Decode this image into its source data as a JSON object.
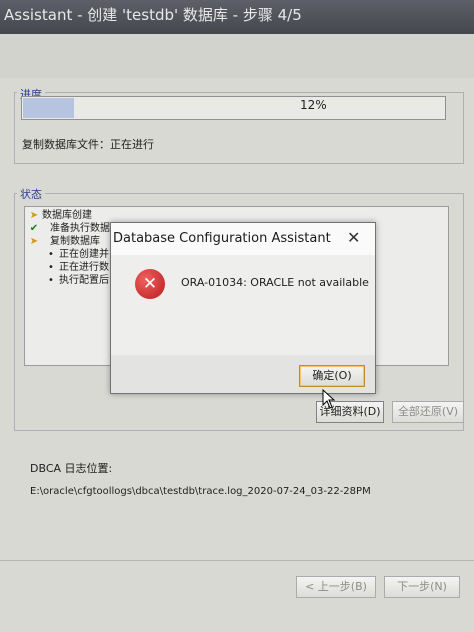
{
  "window": {
    "title": "Assistant - 创建 'testdb' 数据库 - 步骤 4/5"
  },
  "progress": {
    "group_label": "进度",
    "percent_text": "12%",
    "value": 0.12,
    "status_text": "复制数据库文件：正在进行"
  },
  "status": {
    "group_label": "状态",
    "items": [
      {
        "icon": "arrow-icon",
        "label": "数据库创建"
      },
      {
        "icon": "check-icon",
        "label": "准备执行数据库操作"
      },
      {
        "icon": "arrow-icon",
        "label": "复制数据库"
      },
      {
        "icon": "dot-icon",
        "label": "正在创建并"
      },
      {
        "icon": "dot-icon",
        "label": "正在进行数"
      },
      {
        "icon": "dot-icon",
        "label": "执行配置后"
      }
    ]
  },
  "buttons": {
    "details": "详细资料(D)",
    "restore_all": "全部还原(V)",
    "back": "< 上一步(B)",
    "next": "下一步(N)"
  },
  "log": {
    "label": "DBCA 日志位置:",
    "path": "E:\\oracle\\cfgtoollogs\\dbca\\testdb\\trace.log_2020-07-24_03-22-28PM"
  },
  "dialog": {
    "title": "Database Configuration Assistant",
    "message": "ORA-01034: ORACLE not available",
    "ok_label": "确定(O)",
    "icon": "error-icon",
    "close_icon": "close-icon"
  },
  "colors": {
    "error": "#c62828",
    "progress_fill": "#b6c4e0",
    "ok_border": "#c58a22"
  }
}
